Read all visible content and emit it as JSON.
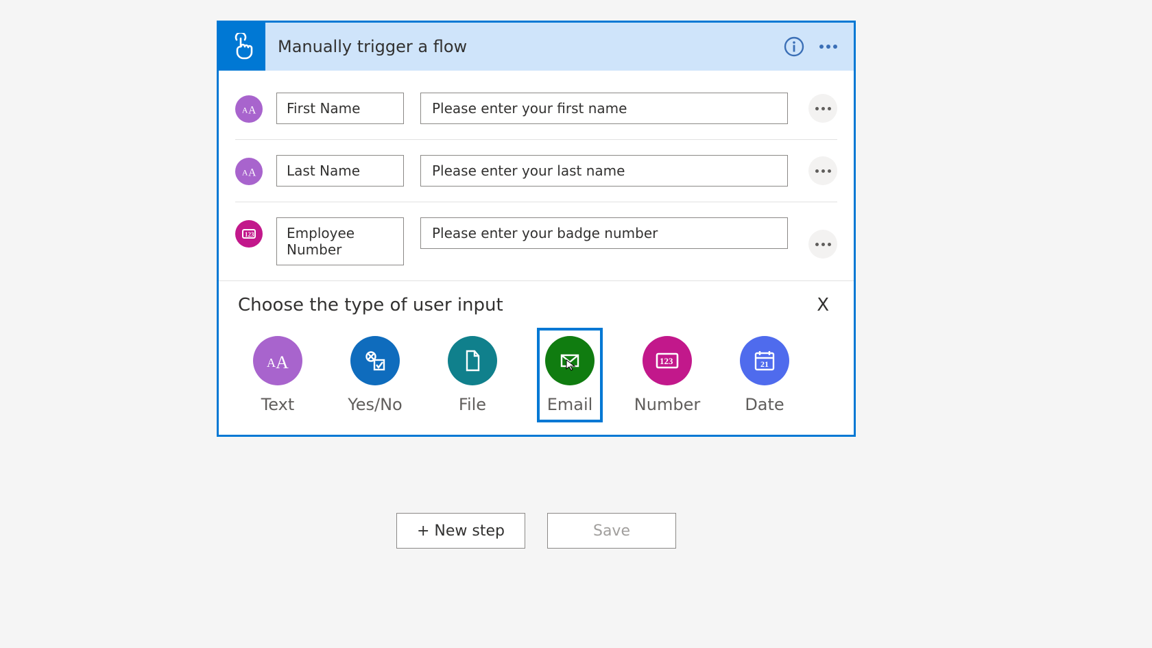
{
  "header": {
    "title": "Manually trigger a flow"
  },
  "inputs": [
    {
      "kind": "text",
      "name": "First Name",
      "description": "Please enter your first name"
    },
    {
      "kind": "text",
      "name": "Last Name",
      "description": "Please enter your last name"
    },
    {
      "kind": "number",
      "name": "Employee Number",
      "description": "Please enter your badge number"
    }
  ],
  "chooser": {
    "title": "Choose the type of user input",
    "close": "X",
    "types": [
      {
        "id": "text",
        "label": "Text"
      },
      {
        "id": "yesno",
        "label": "Yes/No"
      },
      {
        "id": "file",
        "label": "File"
      },
      {
        "id": "email",
        "label": "Email",
        "selected": true
      },
      {
        "id": "number",
        "label": "Number"
      },
      {
        "id": "date",
        "label": "Date"
      }
    ]
  },
  "buttons": {
    "newStep": "+ New step",
    "save": "Save"
  }
}
